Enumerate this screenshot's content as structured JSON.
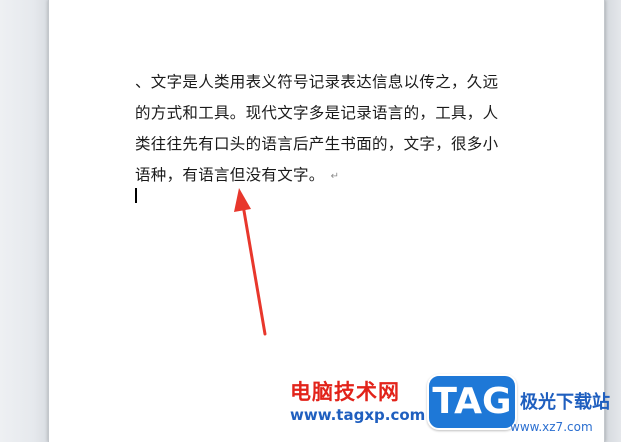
{
  "document": {
    "lines": [
      "、文字是人类用表义符号记录表达信息以传之，久远",
      "的方式和工具。现代文字多是记录语言的，工具，人",
      "类往往先有口头的语言后产生书面的，文字，很多小",
      "语种，有语言但没有文字。"
    ],
    "paragraph_mark": "↵"
  },
  "annotation": {
    "arrow_color": "#e8372c"
  },
  "watermark": {
    "site_name": "电脑技术网",
    "site_url": "www.tagxp.com",
    "logo_text": "TAG",
    "side_text": "极光下载站",
    "side_url": "www.xz7.com",
    "brand_red": "#e2231a",
    "brand_blue": "#1e78d7"
  }
}
